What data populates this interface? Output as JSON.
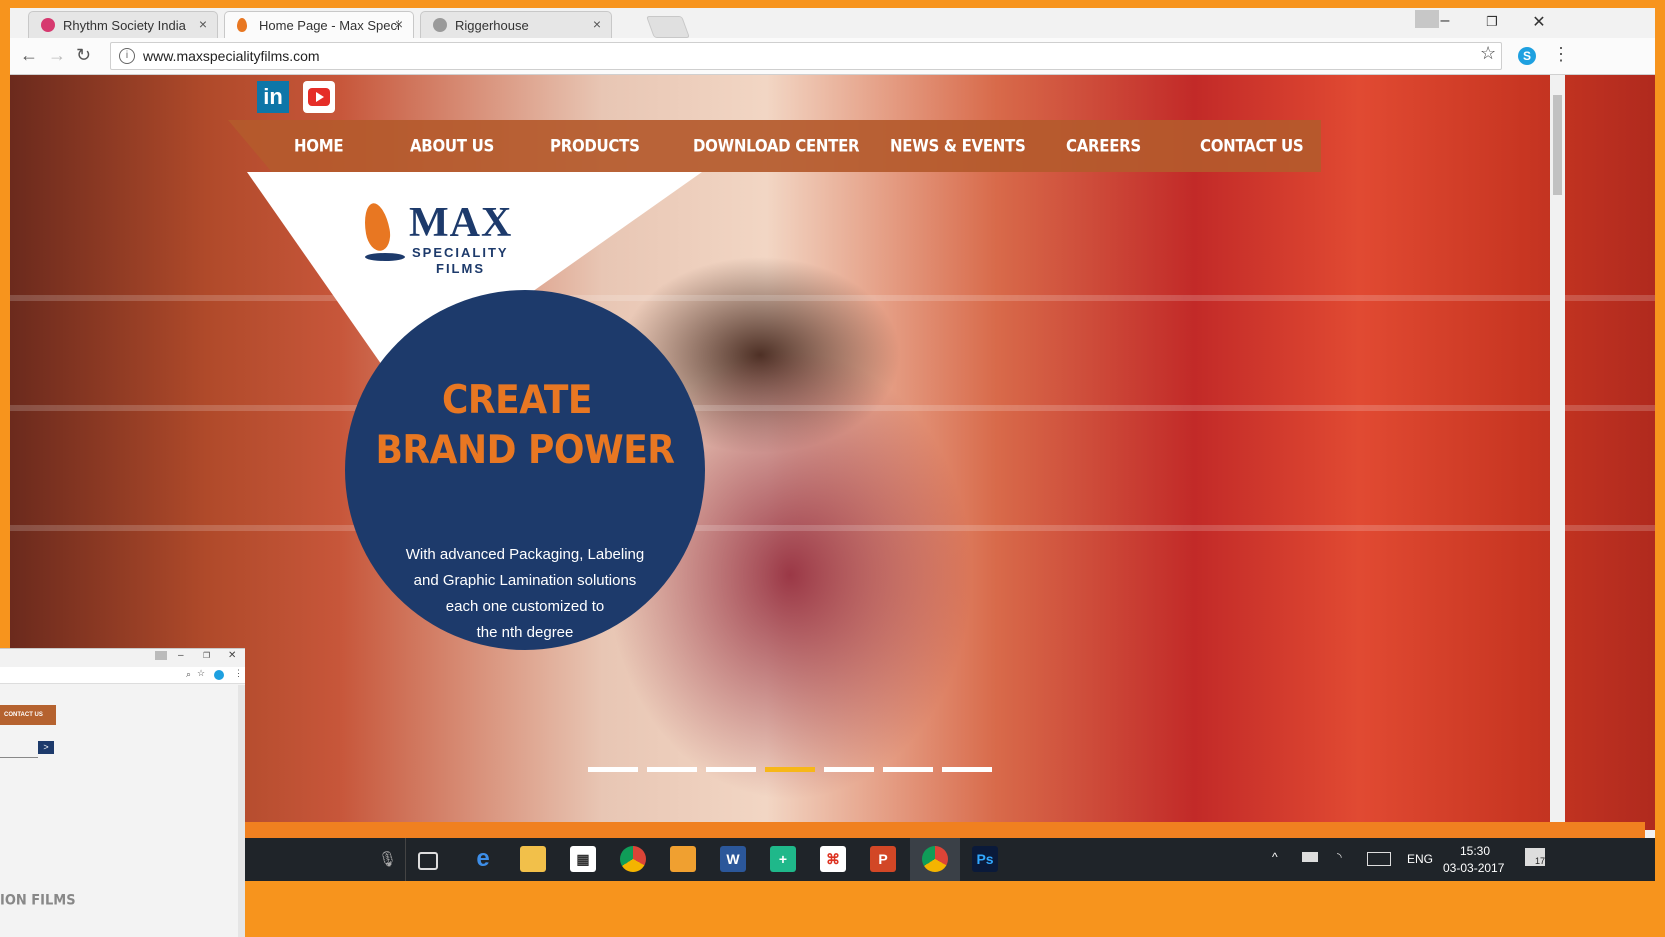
{
  "browser": {
    "tabs": [
      {
        "title": "Rhythm Society India",
        "active": false,
        "favicon_color": "#d6396f"
      },
      {
        "title": "Home Page - Max Specia",
        "active": true,
        "favicon_color": "#e87722"
      },
      {
        "title": "Riggerhouse",
        "active": false,
        "favicon_color": "#9a9a9a"
      }
    ],
    "close_glyph": "×",
    "url": "www.maxspecialityfilms.com",
    "info_glyph": "i",
    "back_glyph": "←",
    "forward_glyph": "→",
    "reload_glyph": "↻",
    "star_glyph": "☆",
    "skype_glyph": "S",
    "menu_glyph": "⋮",
    "minimize_glyph": "–",
    "restore_glyph": "❐",
    "window_close_glyph": "✕"
  },
  "site": {
    "social": {
      "linkedin": "in"
    },
    "nav": [
      "HOME",
      "ABOUT US",
      "PRODUCTS",
      "DOWNLOAD CENTER",
      "NEWS & EVENTS",
      "CAREERS",
      "CONTACT US"
    ],
    "logo": {
      "word": "MAX",
      "line1": "SPECIALITY",
      "line2": "FILMS"
    },
    "hero": {
      "headline1": "CREATE",
      "headline2": "BRAND POWER",
      "sub_lines": [
        "With advanced Packaging, Labeling",
        "and Graphic Lamination solutions",
        "each one customized to",
        "the nth degree"
      ]
    },
    "slider": {
      "count": 7,
      "active_index": 3
    },
    "colors": {
      "navy": "#1d3a6b",
      "orange": "#e87722",
      "nav_bg": "#b45a2d",
      "active_dot": "#f7b718"
    }
  },
  "mini_window": {
    "contact_label": "CONTACT US",
    "arrow_glyph": ">",
    "footer_text": "ION FILMS"
  },
  "taskbar": {
    "mic_glyph": "🎙",
    "icons": [
      "edge",
      "file-explorer",
      "store",
      "chrome",
      "outlook",
      "word",
      "calculator",
      "acrobat",
      "powerpoint",
      "chrome-active",
      "photoshop"
    ],
    "word_letter": "W",
    "photoshop_letters": "Ps",
    "lang": "ENG",
    "time": "15:30",
    "date": "03-03-2017",
    "notification_count": "17",
    "chevron_glyph": "^"
  }
}
